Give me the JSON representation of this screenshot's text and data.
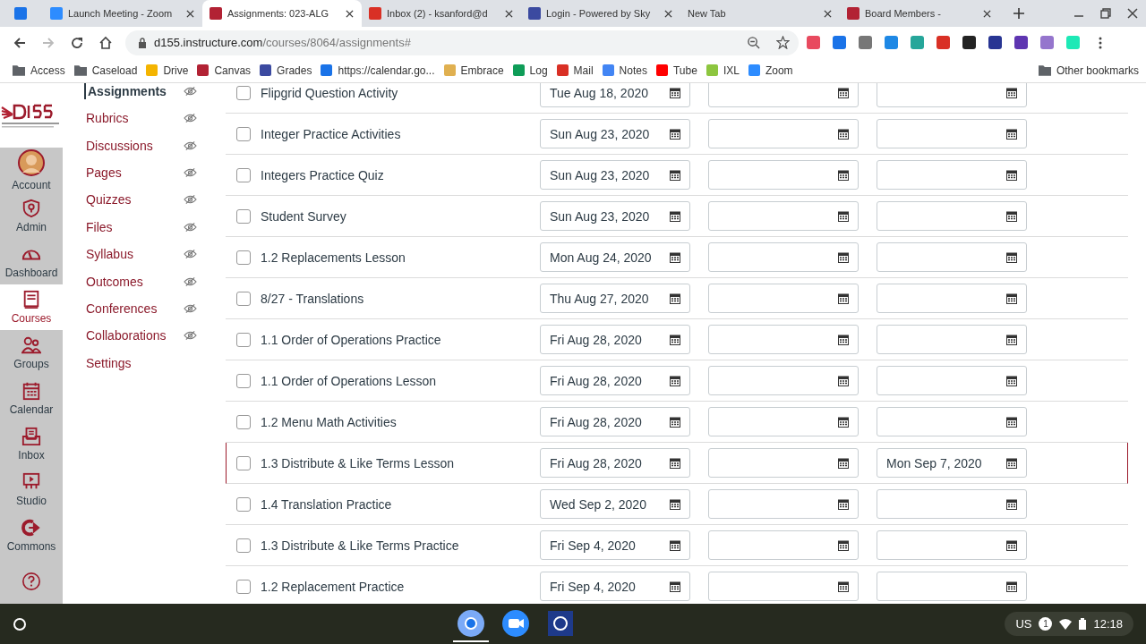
{
  "browser": {
    "tabs": [
      {
        "kind": "calendar",
        "selected": false
      },
      {
        "kind": "zoom",
        "title": "Launch Meeting - Zoom",
        "selected": false
      },
      {
        "kind": "canvas",
        "title": "Assignments: 023-ALG",
        "selected": true
      },
      {
        "kind": "gmail",
        "title": "Inbox (2) - ksanford@d",
        "selected": false
      },
      {
        "kind": "sky",
        "title": "Login - Powered by Sky",
        "selected": false
      },
      {
        "kind": "none",
        "title": "New Tab",
        "selected": false
      },
      {
        "kind": "canvas",
        "title": "Board Members -",
        "selected": false
      }
    ],
    "url_host": "d155.instructure.com",
    "url_path": "/courses/8064/assignments#",
    "bookmarks": [
      {
        "kind": "folder",
        "label": "Access"
      },
      {
        "kind": "folder",
        "label": "Caseload"
      },
      {
        "kind": "drive",
        "label": "Drive"
      },
      {
        "kind": "canvas",
        "label": "Canvas"
      },
      {
        "kind": "sky",
        "label": "Grades"
      },
      {
        "kind": "calendar",
        "label": "https://calendar.go..."
      },
      {
        "kind": "embrace",
        "label": "Embrace"
      },
      {
        "kind": "sheet",
        "label": "Log"
      },
      {
        "kind": "gmail",
        "label": "Mail"
      },
      {
        "kind": "notes",
        "label": "Notes"
      },
      {
        "kind": "youtube",
        "label": "Tube"
      },
      {
        "kind": "ixl",
        "label": "IXL"
      },
      {
        "kind": "zoom",
        "label": "Zoom"
      }
    ],
    "other_bookmarks": "Other bookmarks"
  },
  "global_nav": [
    {
      "kind": "account",
      "label": "Account",
      "selected": false
    },
    {
      "kind": "admin",
      "label": "Admin",
      "selected": false
    },
    {
      "kind": "dashboard",
      "label": "Dashboard",
      "selected": false
    },
    {
      "kind": "courses",
      "label": "Courses",
      "selected": true
    },
    {
      "kind": "groups",
      "label": "Groups",
      "selected": false
    },
    {
      "kind": "calendar",
      "label": "Calendar",
      "selected": false
    },
    {
      "kind": "inbox",
      "label": "Inbox",
      "selected": false
    },
    {
      "kind": "studio",
      "label": "Studio",
      "selected": false
    },
    {
      "kind": "commons",
      "label": "Commons",
      "selected": false
    },
    {
      "kind": "help",
      "selected": false
    }
  ],
  "course_nav": [
    {
      "label": "Assignments",
      "selected": true,
      "hidden": true
    },
    {
      "label": "Rubrics",
      "selected": false,
      "hidden": true
    },
    {
      "label": "Discussions",
      "selected": false,
      "hidden": true
    },
    {
      "label": "Pages",
      "selected": false,
      "hidden": true
    },
    {
      "label": "Quizzes",
      "selected": false,
      "hidden": true
    },
    {
      "label": "Files",
      "selected": false,
      "hidden": true
    },
    {
      "label": "Syllabus",
      "selected": false,
      "hidden": true
    },
    {
      "label": "Outcomes",
      "selected": false,
      "hidden": true
    },
    {
      "label": "Conferences",
      "selected": false,
      "hidden": true
    },
    {
      "label": "Collaborations",
      "selected": false,
      "hidden": true
    },
    {
      "label": "Settings",
      "selected": false,
      "hidden": false
    }
  ],
  "assignments": [
    {
      "name": "Flipgrid Question Activity",
      "checked": false,
      "due": "Tue Aug 18, 2020",
      "highlighted": false
    },
    {
      "name": "Integer Practice Activities",
      "checked": false,
      "due": "Sun Aug 23, 2020",
      "highlighted": false
    },
    {
      "name": "Integers Practice Quiz",
      "checked": false,
      "due": "Sun Aug 23, 2020",
      "highlighted": false
    },
    {
      "name": "Student Survey",
      "checked": false,
      "due": "Sun Aug 23, 2020",
      "highlighted": false
    },
    {
      "name": "1.2 Replacements Lesson",
      "checked": false,
      "due": "Mon Aug 24, 2020",
      "highlighted": false
    },
    {
      "name": "8/27 - Translations",
      "checked": false,
      "due": "Thu Aug 27, 2020",
      "highlighted": false
    },
    {
      "name": "1.1 Order of Operations Practice",
      "checked": false,
      "due": "Fri Aug 28, 2020",
      "highlighted": false
    },
    {
      "name": "1.1 Order of Operations Lesson",
      "checked": false,
      "due": "Fri Aug 28, 2020",
      "highlighted": false
    },
    {
      "name": "1.2 Menu Math Activities",
      "checked": false,
      "due": "Fri Aug 28, 2020",
      "highlighted": false
    },
    {
      "name": "1.3 Distribute & Like Terms Lesson",
      "checked": false,
      "due": "Fri Aug 28, 2020",
      "until": "Mon Sep 7, 2020",
      "highlighted": true
    },
    {
      "name": "1.4 Translation Practice",
      "checked": false,
      "due": "Wed Sep 2, 2020",
      "highlighted": false
    },
    {
      "name": "1.3 Distribute & Like Terms Practice",
      "checked": false,
      "due": "Fri Sep 4, 2020",
      "highlighted": false
    },
    {
      "name": "1.2 Replacement Practice",
      "checked": false,
      "due": "Fri Sep 4, 2020",
      "highlighted": false
    }
  ],
  "shelf": {
    "apps": [
      {
        "kind": "chrome",
        "selected": true
      },
      {
        "kind": "zoom",
        "selected": false
      },
      {
        "kind": "app",
        "selected": false
      }
    ],
    "input_method": "US",
    "notifications": "1",
    "time": "12:18"
  }
}
